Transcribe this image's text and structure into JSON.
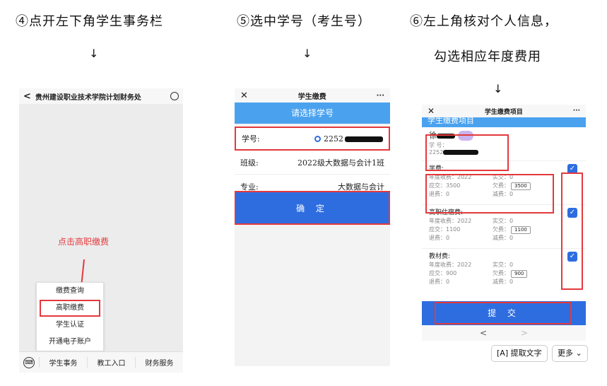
{
  "steps": [
    {
      "caption": "④点开左下角学生事务栏",
      "arrow": "↓"
    },
    {
      "caption": "⑤选中学号（考生号）",
      "arrow": "↓"
    },
    {
      "caption_line1": "⑥左上角核对个人信息，",
      "caption_line2": "勾选相应年度费用",
      "arrow": "↓"
    }
  ],
  "phone1": {
    "title": "贵州建设职业技术学院计划财务处",
    "hint": "点击高职缴费",
    "menu": [
      "缴费查询",
      "高职缴费",
      "学生认证",
      "开通电子账户"
    ],
    "tabs": [
      "学生事务",
      "教工入口",
      "财务服务"
    ]
  },
  "phone2": {
    "title": "学生缴费",
    "more": "···",
    "header": "请选择学号",
    "rows": [
      {
        "label": "学号:",
        "value": "2252"
      },
      {
        "label": "班级:",
        "value": "2022级大数据与会计1班"
      },
      {
        "label": "专业:",
        "value": "大数据与会计"
      }
    ],
    "confirm": "确 定"
  },
  "phone3": {
    "title": "学生缴费项目",
    "more": "···",
    "header": "学生缴费项目",
    "student": {
      "name": "徐",
      "id_label": "学  号：",
      "id_prefix": "2252"
    },
    "fees": [
      {
        "name": "学费:",
        "year": "年度收费：2022",
        "paid": "实交：0",
        "due": "应交：3500",
        "owe_label": "欠费：",
        "owe": "3500",
        "refund": "退费：0",
        "reduce": "减费：0"
      },
      {
        "name": "高职住宿费:",
        "year": "年度收费：2022",
        "paid": "实交：0",
        "due": "应交：1100",
        "owe_label": "欠费：",
        "owe": "1100",
        "refund": "退费：0",
        "reduce": "减费：0"
      },
      {
        "name": "教材费:",
        "year": "年度收费：2022",
        "paid": "实交：0",
        "due": "应交：900",
        "owe_label": "欠费：",
        "owe": "900",
        "refund": "退费：0",
        "reduce": "减费：0"
      }
    ],
    "submit": "提 交",
    "nav_prev": "<",
    "nav_next": ">"
  },
  "bottom_actions": {
    "extract": "提取文字",
    "more": "更多"
  },
  "colors": {
    "accent_blue": "#2d6de0",
    "header_blue": "#4aa2ef",
    "highlight_red": "#e4393c"
  }
}
